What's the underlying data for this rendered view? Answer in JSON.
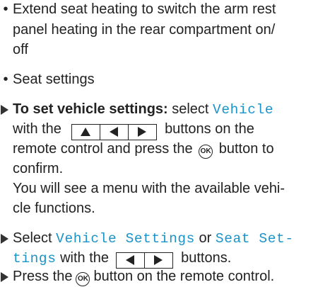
{
  "bullets": {
    "symbol": "•",
    "item1_lines": [
      "Extend seat heating to switch the arm rest",
      "panel heating in the rear compartment on/",
      "off"
    ],
    "item2": "Seat settings"
  },
  "step1": {
    "bold_lead": "To set vehicle settings:",
    "text_select": " select ",
    "menu_vehicle": "Vehicle",
    "text_with_the": "with the",
    "text_buttons_on_the": "buttons on the",
    "text_remote_and_press": "remote control and press the",
    "ok_label": "OK",
    "text_button_to": "button to",
    "text_confirm": "confirm.",
    "note_lines": [
      "You will see a menu with the available vehi-",
      "cle functions."
    ]
  },
  "step2": {
    "text_select": "Select ",
    "menu_vehicle_settings": "Vehicle Settings",
    "text_or": " or ",
    "menu_seat_set_part1": "Seat Set-",
    "menu_seat_set_part2": "tings",
    "text_with_the": " with the",
    "text_buttons": "buttons."
  },
  "step3": {
    "text_press_the": "Press the",
    "ok_label": "OK",
    "text_rest": "button on the remote control."
  },
  "colors": {
    "menu_text": "#1b93c9",
    "body_text": "#222222"
  },
  "icons": {
    "up": "up-triangle",
    "left": "left-triangle",
    "right": "right-triangle",
    "ok": "ok-circle",
    "step": "right-arrow-marker"
  }
}
